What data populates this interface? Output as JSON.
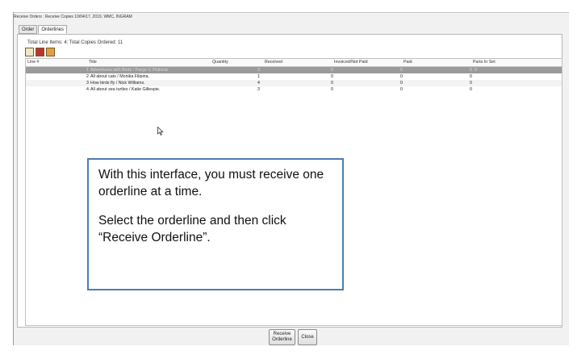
{
  "window": {
    "title": "Receive Orders : Receive Copies  10/04/17, 2019, WMC, INGRAM"
  },
  "tabs": [
    {
      "label": "Order"
    },
    {
      "label": "Orderlines"
    }
  ],
  "summary": "Total Line Items: 4;  Total Copies Ordered: 11",
  "toolbar_icons": [
    "document-icon",
    "book-icon",
    "receive-icon"
  ],
  "table": {
    "columns": [
      "Line #",
      "Title",
      "Quantity",
      "Received",
      "Invoiced/Not Paid",
      "Paid",
      "Parts In Set"
    ],
    "rows": [
      {
        "line": "1",
        "title": "Adventures with Birds / Parge V. Polincia",
        "quantity": "3",
        "received": "0",
        "invoiced": "0",
        "paid": "0",
        "parts": "0"
      },
      {
        "line": "2",
        "title": "All about cats / Monika Filipina.",
        "quantity": "1",
        "received": "0",
        "invoiced": "0",
        "paid": "0",
        "parts": ""
      },
      {
        "line": "3",
        "title": "How birds fly / Nick Williams.",
        "quantity": "4",
        "received": "0",
        "invoiced": "0",
        "paid": "0",
        "parts": ""
      },
      {
        "line": "4",
        "title": "All about sea turtles / Katie Gillespie.",
        "quantity": "3",
        "received": "0",
        "invoiced": "0",
        "paid": "0",
        "parts": ""
      }
    ]
  },
  "buttons": {
    "receive_line1": "Receive",
    "receive_line2": "Orderline",
    "close": "Close"
  },
  "callout": {
    "paragraph1": "With this interface, you must receive one orderline at a time.",
    "paragraph2": "Select the orderline and then click “Receive Orderline”."
  }
}
